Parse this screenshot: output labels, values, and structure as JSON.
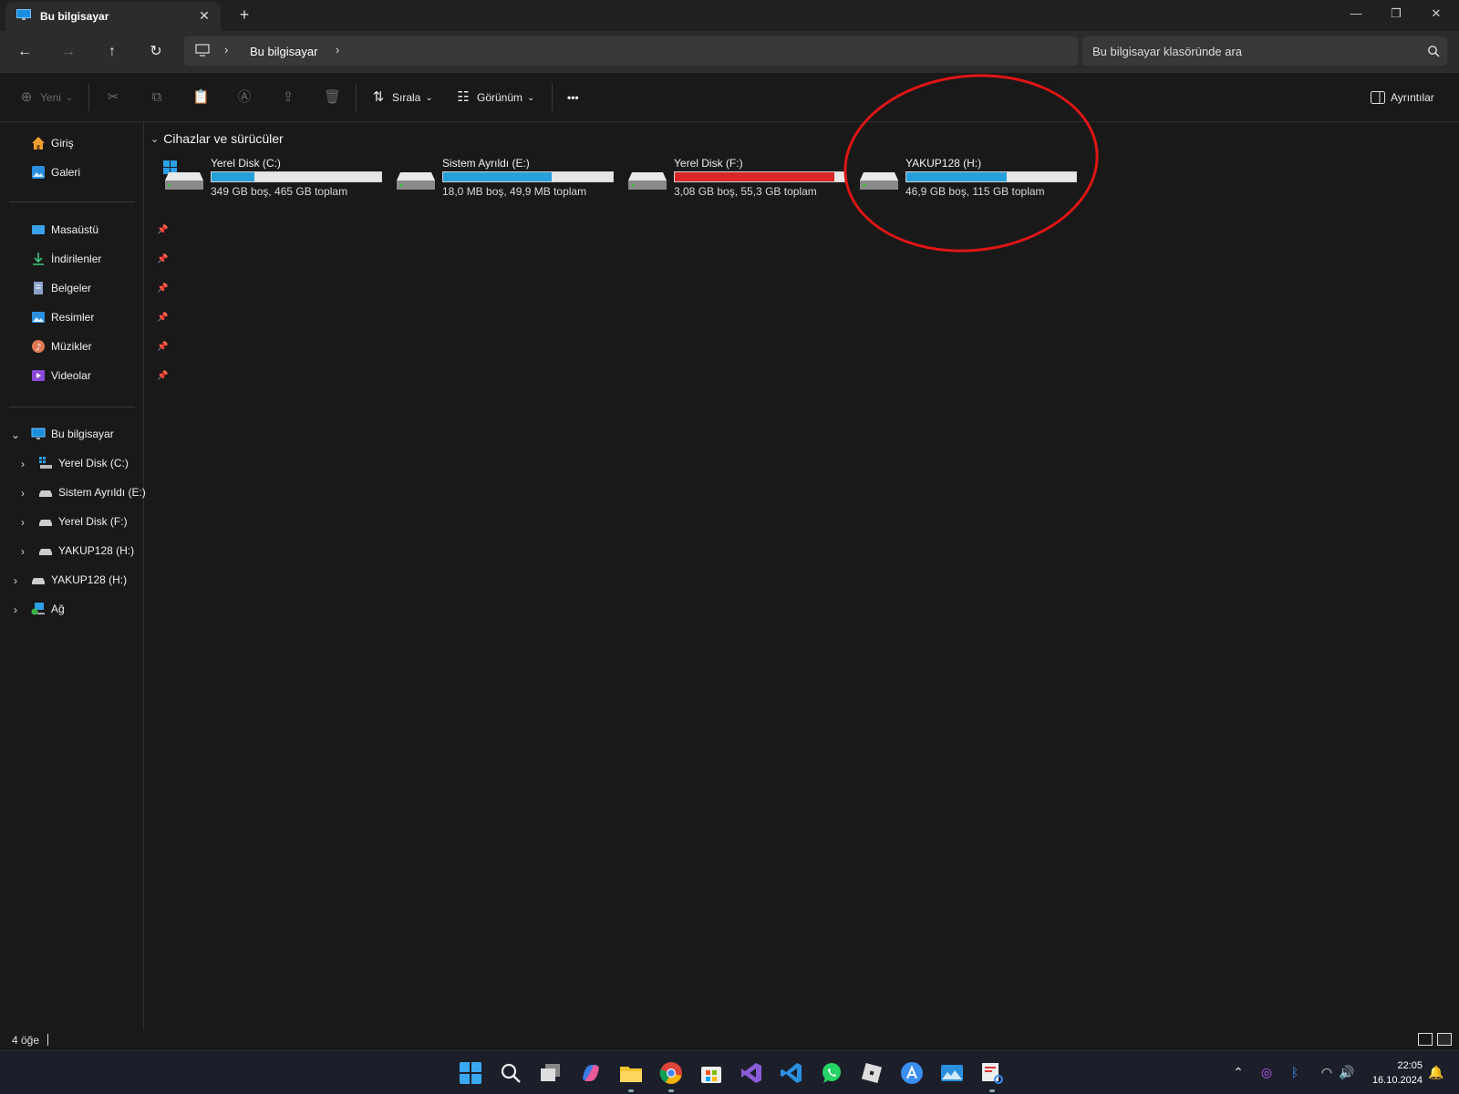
{
  "window": {
    "tab_title": "Bu bilgisayar",
    "close_glyph": "✕",
    "new_tab_glyph": "+",
    "controls": {
      "minimize": "—",
      "maximize": "❐",
      "close": "✕"
    }
  },
  "nav": {
    "back_glyph": "←",
    "forward_glyph": "→",
    "up_glyph": "↑",
    "refresh_glyph": "↻",
    "breadcrumb_sep": "›",
    "breadcrumb": "Bu bilgisayar",
    "search_placeholder": "Bu bilgisayar klasöründe ara"
  },
  "commands": {
    "new_label": "Yeni",
    "sort_label": "Sırala",
    "view_label": "Görünüm",
    "more_label": "•••",
    "details_label": "Ayrıntılar",
    "dropdown_glyph": "⌄"
  },
  "sidebar": {
    "quick": [
      {
        "label": "Giriş",
        "icon": "home-icon"
      },
      {
        "label": "Galeri",
        "icon": "gallery-icon"
      }
    ],
    "pinned": [
      {
        "label": "Masaüstü",
        "icon": "desktop-icon"
      },
      {
        "label": "İndirilenler",
        "icon": "downloads-icon"
      },
      {
        "label": "Belgeler",
        "icon": "documents-icon"
      },
      {
        "label": "Resimler",
        "icon": "pictures-icon"
      },
      {
        "label": "Müzikler",
        "icon": "music-icon"
      },
      {
        "label": "Videolar",
        "icon": "videos-icon"
      }
    ],
    "pin_glyph": "📌",
    "this_pc": "Bu bilgisayar",
    "this_pc_children": [
      "Yerel Disk (C:)",
      "Sistem Ayrıldı (E:)",
      "Yerel Disk (F:)",
      "YAKUP128 (H:)"
    ],
    "removable": "YAKUP128 (H:)",
    "network": "Ağ",
    "expand_glyph": "›",
    "collapse_glyph": "⌄"
  },
  "main": {
    "group_title": "Cihazlar ve sürücüler",
    "group_chevron": "⌄",
    "drives": [
      {
        "name": "Yerel Disk (C:)",
        "info": "349 GB boş, 465 GB toplam",
        "used_fraction": 0.25,
        "full": false,
        "windows": true
      },
      {
        "name": "Sistem Ayrıldı (E:)",
        "info": "18,0 MB boş, 49,9 MB toplam",
        "used_fraction": 0.64,
        "full": false,
        "windows": false
      },
      {
        "name": "Yerel Disk (F:)",
        "info": "3,08 GB boş, 55,3 GB toplam",
        "used_fraction": 0.94,
        "full": true,
        "windows": false
      },
      {
        "name": "YAKUP128 (H:)",
        "info": "46,9 GB boş, 115 GB toplam",
        "used_fraction": 0.59,
        "full": false,
        "windows": false
      }
    ],
    "annotation_color": "#e01515"
  },
  "status": {
    "item_count": "4 öğe"
  },
  "taskbar": {
    "time": "22:05",
    "date": "16.10.2024",
    "apps": [
      "start-icon",
      "search-icon",
      "task-view-icon",
      "copilot-icon",
      "file-explorer-icon",
      "chrome-icon",
      "store-icon",
      "visual-studio-icon",
      "vscode-icon",
      "whatsapp-icon",
      "roblox-icon",
      "app-store-icon",
      "photos-icon",
      "snipping-tool-icon"
    ]
  },
  "colors": {
    "accent": "#26a0da",
    "drive_full": "#da2626",
    "background": "#191919"
  }
}
